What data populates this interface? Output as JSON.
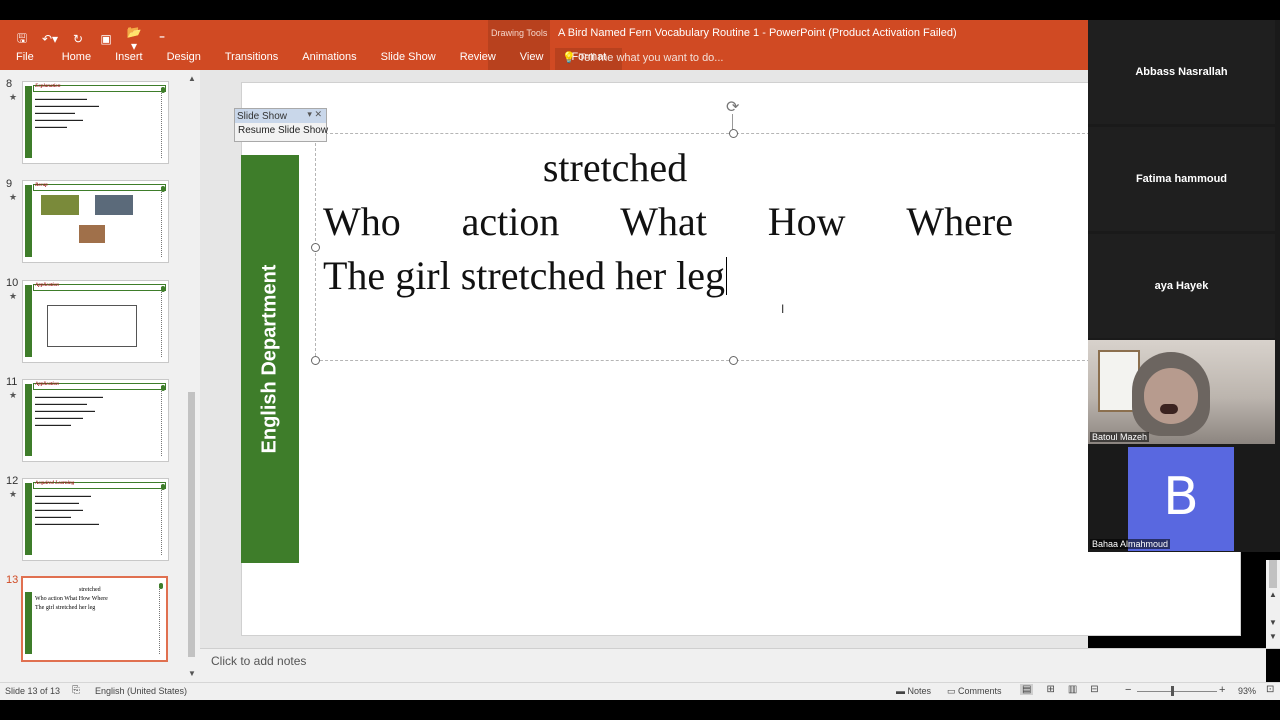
{
  "window": {
    "title": "A Bird Named Fern Vocabulary Routine 1 - PowerPoint (Product Activation Failed)",
    "contextual_label": "Drawing Tools"
  },
  "ribbon": {
    "tabs": [
      "File",
      "Home",
      "Insert",
      "Design",
      "Transitions",
      "Animations",
      "Slide Show",
      "Review",
      "View",
      "Format"
    ],
    "active_tab": "Format",
    "tell_me": "Tell me what you want to do..."
  },
  "thumbnails": [
    {
      "num": "8",
      "title": "Explanation"
    },
    {
      "num": "9",
      "title": "Recap"
    },
    {
      "num": "10",
      "title": "Application"
    },
    {
      "num": "11",
      "title": "Application"
    },
    {
      "num": "12",
      "title": "Acquired Learning"
    },
    {
      "num": "13",
      "lines": [
        "stretched",
        "Who   action   What   How   Where",
        "The girl stretched her leg"
      ]
    }
  ],
  "slide": {
    "side_label": "English Department",
    "line1": "stretched",
    "line2_words": [
      "Who",
      "action",
      "What",
      "How",
      "Where"
    ],
    "line3": "The girl stretched her leg"
  },
  "slideshow_toolbar": {
    "title": "Slide Show",
    "button": "Resume Slide Show"
  },
  "notes": {
    "placeholder": "Click to add notes"
  },
  "status": {
    "slide_info": "Slide 13 of 13",
    "language": "English (United States)",
    "notes_label": "Notes",
    "comments_label": "Comments",
    "zoom": "93%"
  },
  "participants": [
    {
      "name": "Abbass Nasrallah",
      "mode": "name"
    },
    {
      "name": "Fatima  hammoud",
      "mode": "name"
    },
    {
      "name": "aya Hayek",
      "mode": "name"
    },
    {
      "name": "Batoul Mazeh",
      "mode": "camera"
    },
    {
      "name": "Bahaa Almahmoud",
      "mode": "avatar",
      "initial": "B"
    }
  ],
  "colors": {
    "ribbon": "#d04a23",
    "green": "#3e7d2a",
    "avatar": "#5968e0"
  }
}
